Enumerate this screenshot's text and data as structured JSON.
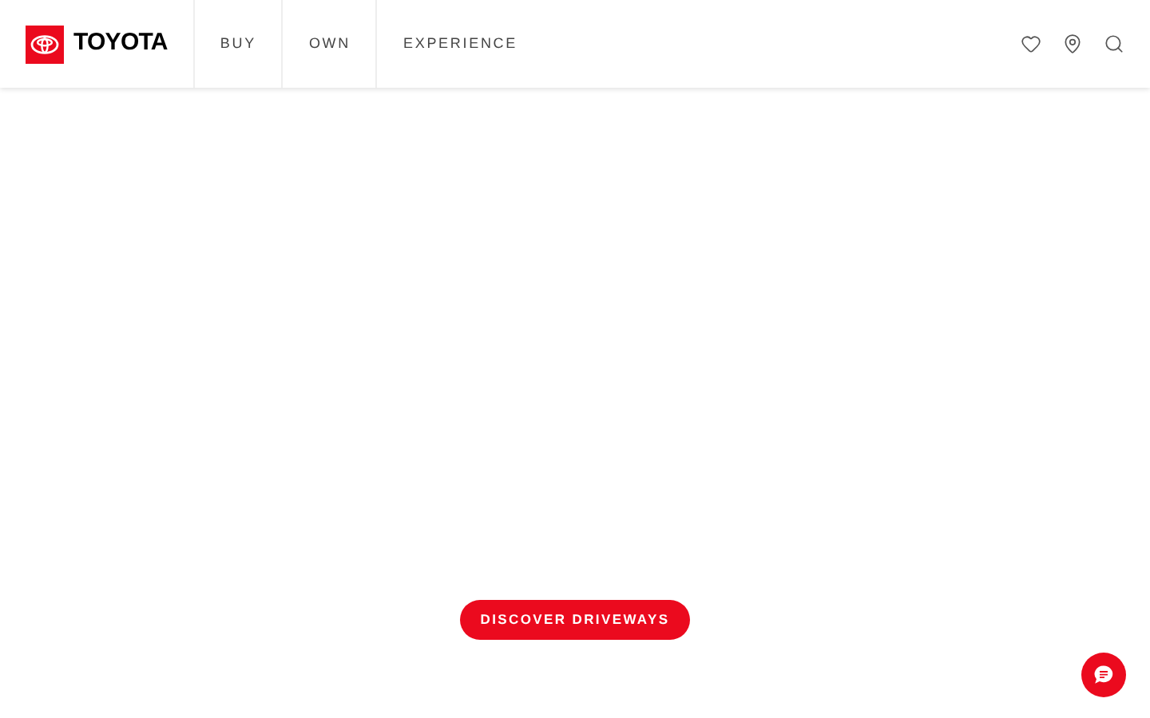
{
  "header": {
    "brand": "TOYOTA",
    "nav": [
      {
        "label": "BUY"
      },
      {
        "label": "OWN"
      },
      {
        "label": "EXPERIENCE"
      }
    ]
  },
  "hero": {
    "button": "DISCOVER DRIVEWAYS"
  }
}
